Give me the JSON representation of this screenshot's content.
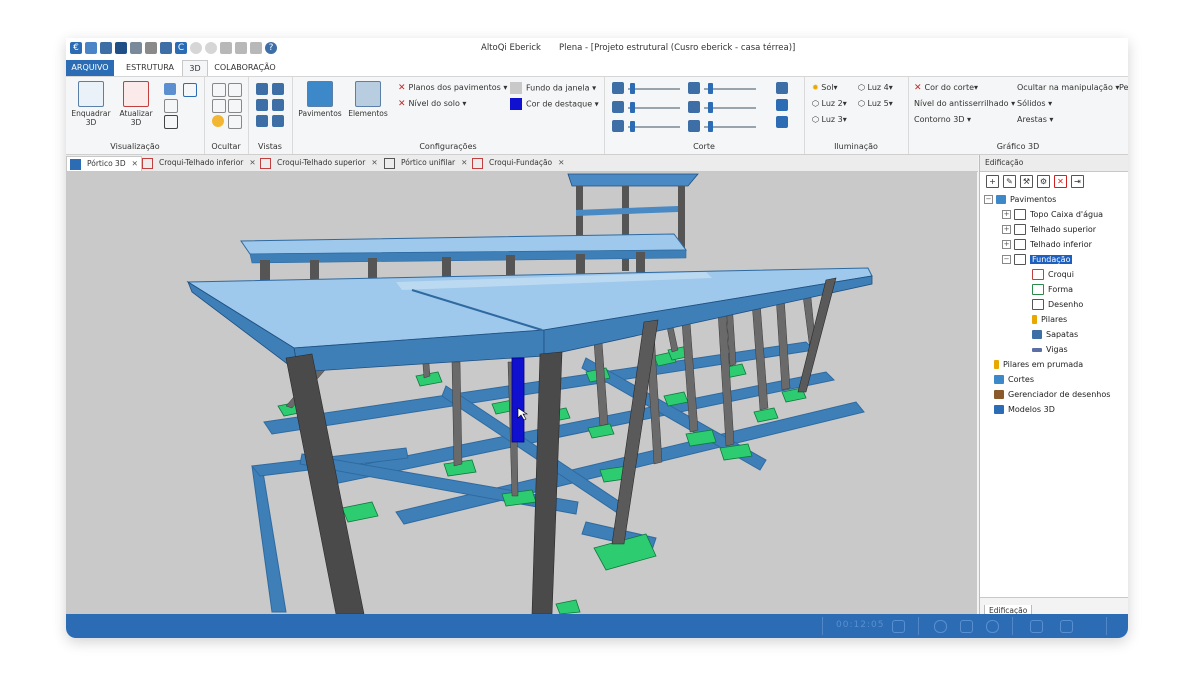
{
  "window": {
    "app_title": "AltoQi Eberick",
    "doc_title": "Plena - [Projeto estrutural (Cusro eberick - casa térrea)]"
  },
  "ribbon_tabs": [
    "ARQUIVO",
    "ESTRUTURA",
    "3D",
    "COLABORAÇÃO"
  ],
  "ribbon": {
    "visualizacao": {
      "label": "Visualização",
      "enquadrar": "Enquadrar 3D",
      "atualizar": "Atualizar 3D"
    },
    "ocultar": {
      "label": "Ocultar"
    },
    "vistas": {
      "label": "Vistas"
    },
    "configuracoes": {
      "label": "Configurações",
      "pavimentos": "Pavimentos",
      "elementos": "Elementos",
      "planos": "Planos dos pavimentos",
      "nivel": "Nível do solo",
      "fundo": "Fundo da janela",
      "destaque": "Cor de destaque"
    },
    "corte": {
      "label": "Corte"
    },
    "iluminacao": {
      "label": "Iluminação",
      "sol": "Sol",
      "luz2": "Luz 2",
      "luz3": "Luz 3",
      "luz4": "Luz 4",
      "luz5": "Luz 5"
    },
    "grafico": {
      "label": "Gráfico 3D",
      "cor_corte": "Cor do corte",
      "antisserrilhado": "Nível do antisserrilhado",
      "contorno": "Contorno 3D",
      "ocultar_manip": "Ocultar na manipulação",
      "solidos": "Sólidos",
      "arestas": "Arestas",
      "pe": "Pe"
    }
  },
  "doc_tabs": [
    {
      "label": "Pórtico 3D"
    },
    {
      "label": "Croqui-Telhado inferior"
    },
    {
      "label": "Croqui-Telhado superior"
    },
    {
      "label": "Pórtico unifilar"
    },
    {
      "label": "Croqui-Fundação"
    }
  ],
  "sidebar": {
    "header": "Edificação",
    "footer_tab": "Edificação",
    "tree": {
      "pavimentos": "Pavimentos",
      "topo": "Topo Caixa d'água",
      "telhado_sup": "Telhado superior",
      "telhado_inf": "Telhado inferior",
      "fundacao": "Fundação",
      "croqui": "Croqui",
      "forma": "Forma",
      "desenho": "Desenho",
      "pilares": "Pilares",
      "sapatas": "Sapatas",
      "vigas": "Vigas",
      "pilares_prumada": "Pilares em prumada",
      "cortes": "Cortes",
      "gerenciador": "Gerenciador de desenhos",
      "modelos": "Modelos 3D"
    }
  },
  "status": {
    "time": "00:12:05"
  },
  "colors": {
    "accent": "#2b6cb4",
    "beam": "#3f7fb8",
    "slab": "#9ec8ec",
    "column": "#4a4a4a",
    "footing": "#2ecc71",
    "highlight": "#1010d0",
    "background": "#c9c9c9"
  }
}
